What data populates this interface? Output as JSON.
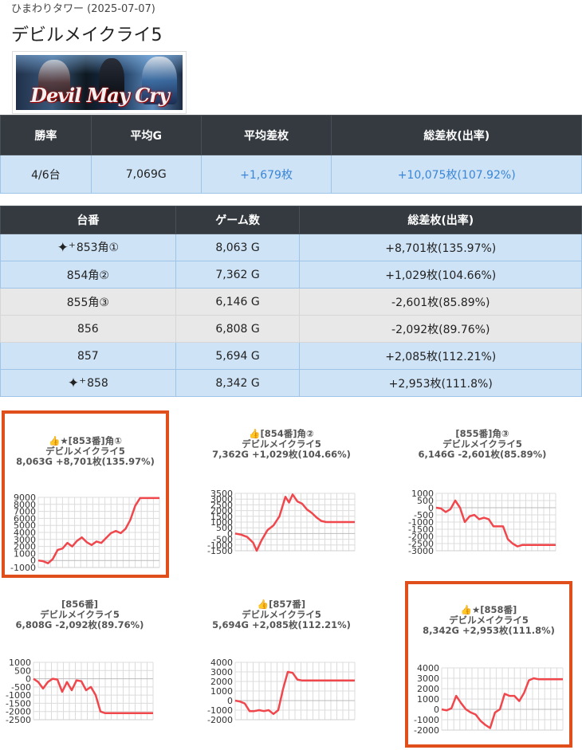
{
  "page": {
    "subtitle": "ひまわりタワー (2025-07-07)",
    "title": "デビルメイクライ5",
    "banner_logo_text": "Devil May Cry 5"
  },
  "summary": {
    "headers": [
      "勝率",
      "平均G",
      "平均差枚",
      "総差枚(出率)"
    ],
    "values": [
      "4/6台",
      "7,069G",
      "+1,679枚",
      "+10,075枚(107.92%)"
    ]
  },
  "machines": {
    "headers": [
      "台番",
      "ゲーム数",
      "総差枚(出率)"
    ],
    "rows": [
      {
        "id": "853角①",
        "games": "8,063 G",
        "diff": "+8,701枚(135.97%)",
        "icon": "sparkle-icon"
      },
      {
        "id": "854角②",
        "games": "7,362 G",
        "diff": "+1,029枚(104.66%)",
        "icon": ""
      },
      {
        "id": "855角③",
        "games": "6,146 G",
        "diff": "-2,601枚(85.89%)",
        "icon": ""
      },
      {
        "id": "856",
        "games": "6,808 G",
        "diff": "-2,092枚(89.76%)",
        "icon": ""
      },
      {
        "id": "857",
        "games": "5,694 G",
        "diff": "+2,085枚(112.21%)",
        "icon": ""
      },
      {
        "id": "858",
        "games": "8,342 G",
        "diff": "+2,953枚(111.8%)",
        "icon": "sparkle-icon"
      }
    ]
  },
  "colors": {
    "header_bg": "#343a40",
    "row_blue": "#cfe3f6",
    "row_gray": "#e8e8e8",
    "positive_text": "#3a86d6",
    "highlight_border": "#e04e1b",
    "line": "#f0474d"
  },
  "chart_data": [
    {
      "type": "line",
      "title_lines": [
        "👍★[853番]角①",
        "デビルメイクライ5",
        "8,063G +8,701枚(135.97%)"
      ],
      "ylim": [
        -1000,
        9000
      ],
      "yticks": [
        -1000,
        0,
        1000,
        2000,
        3000,
        4000,
        5000,
        6000,
        7000,
        8000,
        9000
      ],
      "x": [
        0,
        4,
        8,
        12,
        16,
        20,
        24,
        28,
        32,
        36,
        40,
        44,
        48,
        52,
        56,
        60,
        64,
        68,
        72,
        76,
        80,
        84,
        88,
        92,
        96,
        100
      ],
      "y": [
        0,
        -100,
        -400,
        200,
        1500,
        1700,
        2500,
        2000,
        2800,
        3300,
        2600,
        2200,
        2700,
        2500,
        3200,
        3900,
        4200,
        3900,
        4500,
        5800,
        7800,
        8900,
        8900,
        8900,
        8900,
        8900
      ]
    },
    {
      "type": "line",
      "title_lines": [
        "👍[854番]角②",
        "デビルメイクライ5",
        "7,362G +1,029枚(104.66%)"
      ],
      "ylim": [
        -1500,
        3500
      ],
      "yticks": [
        -1500,
        -1000,
        -500,
        0,
        500,
        1000,
        1500,
        2000,
        2500,
        3000,
        3500
      ],
      "x": [
        0,
        5,
        10,
        15,
        18,
        22,
        27,
        32,
        37,
        42,
        45,
        48,
        52,
        56,
        60,
        64,
        68,
        72,
        76,
        80,
        88,
        100
      ],
      "y": [
        0,
        -100,
        -300,
        -800,
        -1500,
        -600,
        300,
        700,
        1500,
        3200,
        2700,
        3400,
        2800,
        2600,
        2100,
        1800,
        1400,
        1100,
        1000,
        1000,
        1000,
        1000
      ]
    },
    {
      "type": "line",
      "title_lines": [
        "[855番]角③",
        "デビルメイクライ5",
        "6,146G -2,601枚(85.89%)"
      ],
      "ylim": [
        -3000,
        1000
      ],
      "yticks": [
        -3000,
        -2500,
        -2000,
        -1500,
        -1000,
        -500,
        0,
        500,
        1000
      ],
      "x": [
        0,
        4,
        8,
        12,
        16,
        20,
        24,
        28,
        32,
        36,
        40,
        44,
        48,
        52,
        56,
        60,
        64,
        68,
        72,
        76,
        80,
        84,
        88,
        92,
        96,
        100
      ],
      "y": [
        0,
        -50,
        -300,
        -100,
        500,
        0,
        -1000,
        -600,
        -500,
        -800,
        -700,
        -800,
        -1300,
        -1300,
        -1300,
        -2200,
        -2500,
        -2700,
        -2600,
        -2600,
        -2600,
        -2600,
        -2600,
        -2600,
        -2600,
        -2600
      ]
    },
    {
      "type": "line",
      "title_lines": [
        "[856番]",
        "デビルメイクライ5",
        "6,808G -2,092枚(89.76%)"
      ],
      "ylim": [
        -2500,
        1000
      ],
      "yticks": [
        -2500,
        -2000,
        -1500,
        -1000,
        -500,
        0,
        500,
        1000
      ],
      "x": [
        0,
        4,
        8,
        12,
        16,
        20,
        24,
        28,
        32,
        36,
        40,
        44,
        48,
        52,
        56,
        60,
        64,
        68,
        72,
        76,
        80,
        84,
        88,
        92,
        96,
        100
      ],
      "y": [
        0,
        -200,
        -600,
        -200,
        0,
        -50,
        -800,
        -200,
        -700,
        -100,
        -150,
        -700,
        -500,
        -1000,
        -2000,
        -2100,
        -2100,
        -2100,
        -2100,
        -2100,
        -2100,
        -2100,
        -2100,
        -2100,
        -2100,
        -2100
      ]
    },
    {
      "type": "line",
      "title_lines": [
        "👍[857番]",
        "デビルメイクライ5",
        "5,694G +2,085枚(112.21%)"
      ],
      "ylim": [
        -2000,
        4000
      ],
      "yticks": [
        -2000,
        -1000,
        0,
        1000,
        2000,
        3000,
        4000
      ],
      "x": [
        0,
        4,
        8,
        12,
        16,
        20,
        24,
        28,
        32,
        36,
        40,
        44,
        48,
        52,
        56,
        60,
        64,
        68,
        72,
        76,
        80,
        84,
        88,
        92,
        96,
        100
      ],
      "y": [
        0,
        -100,
        -300,
        -1100,
        -1100,
        -1000,
        -1100,
        -1000,
        -1400,
        -1000,
        1200,
        3000,
        2900,
        2200,
        2100,
        2100,
        2100,
        2100,
        2100,
        2100,
        2100,
        2100,
        2100,
        2100,
        2100,
        2100
      ]
    },
    {
      "type": "line",
      "title_lines": [
        "👍★[858番]",
        "デビルメイクライ5",
        "8,342G +2,953枚(111.8%)"
      ],
      "ylim": [
        -2000,
        4000
      ],
      "yticks": [
        -2000,
        -1000,
        0,
        1000,
        2000,
        3000,
        4000
      ],
      "x": [
        0,
        4,
        8,
        12,
        16,
        20,
        24,
        28,
        32,
        36,
        40,
        44,
        48,
        52,
        56,
        60,
        64,
        68,
        72,
        76,
        80,
        84,
        88,
        92,
        96,
        100
      ],
      "y": [
        0,
        -100,
        100,
        1300,
        600,
        0,
        -300,
        -500,
        -1100,
        -1500,
        -1800,
        -300,
        0,
        1500,
        1300,
        1300,
        800,
        1600,
        2800,
        3000,
        2900,
        2900,
        2900,
        2900,
        2900,
        2900
      ]
    }
  ]
}
